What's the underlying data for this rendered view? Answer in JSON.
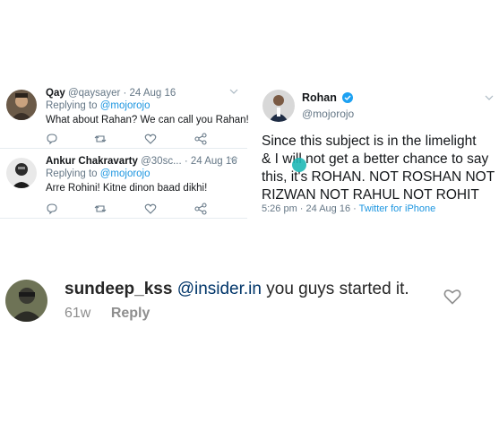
{
  "left_tweets": [
    {
      "name": "Qay",
      "meta": "@qaysayer · 24 Aug 16",
      "replying_prefix": "Replying to ",
      "replying_handle": "@mojorojo",
      "text": "What about Rahan? We can call you Rahan!"
    },
    {
      "name": "Ankur Chakravarty",
      "meta": "@30sc... · 24 Aug 16",
      "replying_prefix": "Replying to ",
      "replying_handle": "@mojorojo",
      "text": "Arre Rohini! Kitne dinon baad dikhi!"
    }
  ],
  "right_tweet": {
    "name": "Rohan",
    "handle": "@mojorojo",
    "lines": [
      "Since this subject is in the limelight",
      "& I will not get a better chance to say",
      "this, it's ROHAN. NOT ROSHAN NOT",
      "RIZWAN NOT RAHUL NOT ROHIT"
    ],
    "timestamp": "5:26 pm · 24 Aug 16 · ",
    "source": "Twitter for iPhone"
  },
  "instagram_comment": {
    "username": "sundeep_kss",
    "mention": "@insider.in",
    "text": " you guys started it.",
    "age": "61w",
    "reply_label": "Reply"
  },
  "colors": {
    "twitter_blue": "#1b95e0",
    "muted_gray": "#657786",
    "touch_indicator": "#1fb8b6"
  },
  "icons": [
    "reply-icon",
    "retweet-icon",
    "like-icon",
    "share-icon",
    "chevron-down-icon",
    "verified-badge-icon",
    "heart-icon"
  ]
}
